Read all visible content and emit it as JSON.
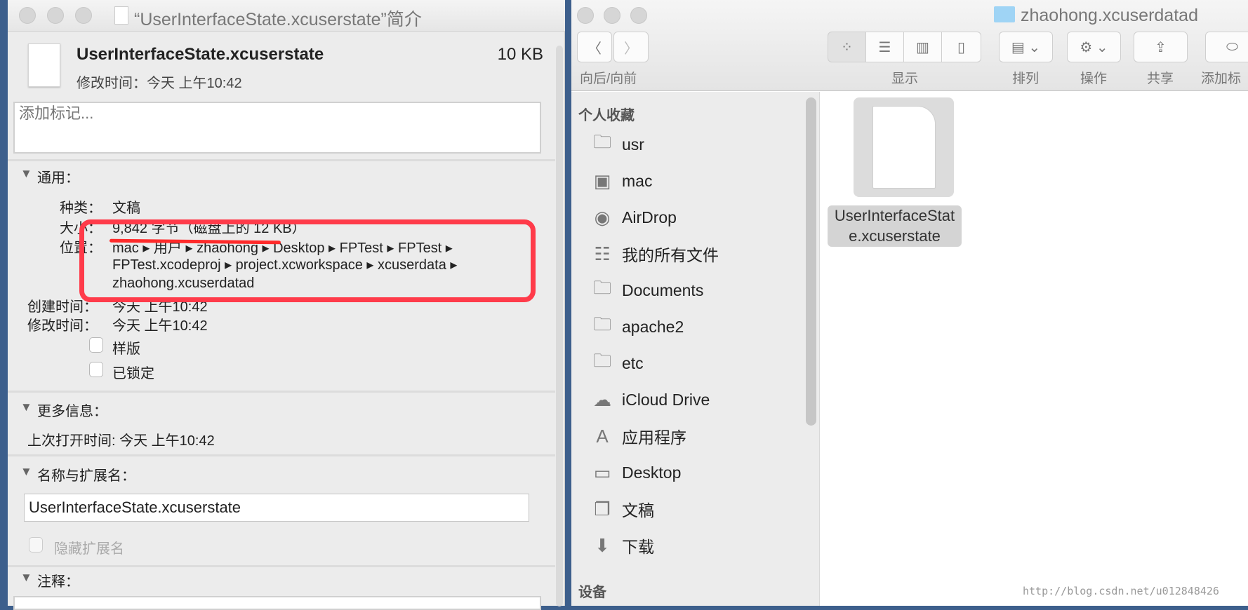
{
  "info_window": {
    "title": "“UserInterfaceState.xcuserstate”简介",
    "file_name": "UserInterfaceState.xcuserstate",
    "file_size": "10 KB",
    "modified_header": "修改时间：今天 上午10:42",
    "tags_placeholder": "添加标记...",
    "general": {
      "header": "通用：",
      "kind_label": "种类：",
      "kind_value": "文稿",
      "size_label": "大小：",
      "size_value": "9,842 字节（磁盘上的 12 KB）",
      "location_label": "位置：",
      "location_line1": "mac ▸ 用户 ▸ zhaohong ▸ Desktop ▸ FPTest ▸ FPTest ▸",
      "location_line2": "FPTest.xcodeproj ▸ project.xcworkspace ▸ xcuserdata ▸",
      "location_line3": "zhaohong.xcuserdatad",
      "created_label": "创建时间：",
      "created_value": "今天 上午10:42",
      "modified_label": "修改时间：",
      "modified_value": "今天 上午10:42",
      "stationery_label": "样版",
      "stationery_checked": false,
      "locked_label": "已锁定",
      "locked_checked": false
    },
    "more_info": {
      "header": "更多信息：",
      "last_opened": "上次打开时间: 今天 上午10:42"
    },
    "name_ext": {
      "header": "名称与扩展名：",
      "value": "UserInterfaceState.xcuserstate",
      "hide_ext_label": "隐藏扩展名",
      "hide_ext_checked": false
    },
    "comments": {
      "header": "注释："
    },
    "annotation_color": "#ff3b4a"
  },
  "finder": {
    "title": "zhaohong.xcuserdatad",
    "toolbar": {
      "nav_label": "向后/向前",
      "view_label": "显示",
      "arrange_label": "排列",
      "action_label": "操作",
      "share_label": "共享",
      "tag_label": "添加标"
    },
    "sidebar": {
      "favorites_header": "个人收藏",
      "devices_header": "设备",
      "items": [
        {
          "label": "usr",
          "icon": "folder-icon"
        },
        {
          "label": "mac",
          "icon": "hard-drive-icon"
        },
        {
          "label": "AirDrop",
          "icon": "airdrop-icon"
        },
        {
          "label": "我的所有文件",
          "icon": "all-files-icon"
        },
        {
          "label": "Documents",
          "icon": "folder-icon"
        },
        {
          "label": "apache2",
          "icon": "folder-icon"
        },
        {
          "label": "etc",
          "icon": "folder-icon"
        },
        {
          "label": "iCloud Drive",
          "icon": "cloud-icon"
        },
        {
          "label": "应用程序",
          "icon": "applications-icon"
        },
        {
          "label": "Desktop",
          "icon": "desktop-icon"
        },
        {
          "label": "文稿",
          "icon": "documents-icon"
        },
        {
          "label": "下载",
          "icon": "downloads-icon"
        }
      ]
    },
    "file": {
      "name_line1": "UserInterfaceStat",
      "name_line2": "e.xcuserstate"
    }
  },
  "watermark": "http://blog.csdn.net/u012848426"
}
